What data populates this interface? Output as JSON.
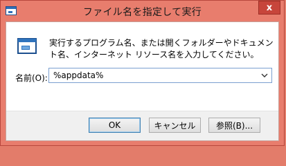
{
  "window": {
    "title": "ファイル名を指定して実行",
    "close_label": "x"
  },
  "dialog": {
    "description": "実行するプログラム名、または開くフォルダーやドキュメント名、インターネット リソース名を入力してください。",
    "open_label": "名前(O):",
    "open_value": "%appdata%"
  },
  "buttons": {
    "ok": "OK",
    "cancel": "キャンセル",
    "browse": "参照(B)..."
  },
  "colors": {
    "titlebar": "#e87d6d",
    "close_button": "#c7453b",
    "client_background": "#ffffff",
    "button_bar": "#f0f0f0"
  },
  "icons": [
    "run-icon",
    "close-icon",
    "chevron-down-icon"
  ]
}
